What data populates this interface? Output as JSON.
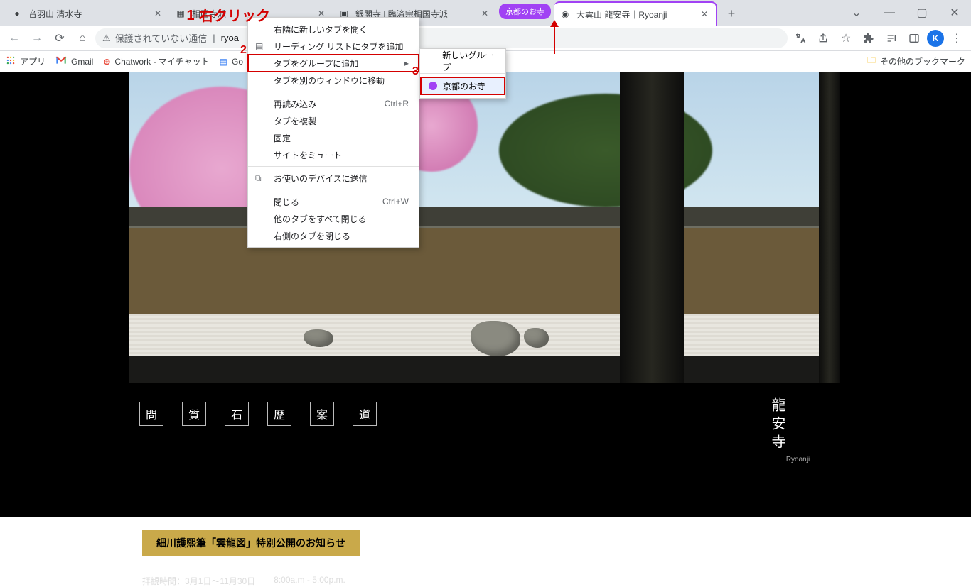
{
  "tabs": [
    {
      "title": "音羽山 清水寺",
      "favicon": "●"
    },
    {
      "title": "相国寺派",
      "favicon": "▦"
    },
    {
      "title": "銀閣寺 | 臨済宗相国寺派",
      "favicon": "▣"
    },
    {
      "title": "大雲山 龍安寺｜Ryoanji",
      "favicon": "◉"
    }
  ],
  "tab_group_chip": "京都のお寺",
  "new_tab_plus": "+",
  "window_controls": {
    "min": "—",
    "max": "▢",
    "close": "✕",
    "chev": "⌄"
  },
  "toolbar": {
    "not_secure": "保護されていない通信",
    "url_fragment": "ryoa",
    "profile_initial": "K"
  },
  "bookmarks": {
    "apps": "アプリ",
    "gmail": "Gmail",
    "chatwork": "Chatwork - マイチャット",
    "google": "Go",
    "other": "その他のブックマーク"
  },
  "context_menu": {
    "open_right": "右隣に新しいタブを開く",
    "reading_list": "リーディング リストにタブを追加",
    "add_to_group": "タブをグループに追加",
    "move_window": "タブを別のウィンドウに移動",
    "reload": "再読み込み",
    "reload_key": "Ctrl+R",
    "duplicate": "タブを複製",
    "pin": "固定",
    "mute": "サイトをミュート",
    "send_device": "お使いのデバイスに送信",
    "close": "閉じる",
    "close_key": "Ctrl+W",
    "close_others": "他のタブをすべて閉じる",
    "close_right": "右側のタブを閉じる"
  },
  "submenu": {
    "new_group": "新しいグループ",
    "existing_group": "京都のお寺"
  },
  "page": {
    "nav": [
      "問",
      "質",
      "石",
      "歴",
      "案",
      "道"
    ],
    "logo_kanji": "龍安寺",
    "logo_roma": "Ryoanji",
    "notice": "細川護煕筆「雲龍図」特別公開のお知らせ",
    "hours_label": "拝観時間：",
    "hours_dates": "3月1日～11月30日",
    "hours_time": "8:00a.m - 5:00p.m."
  },
  "annotations": {
    "one_num": "1",
    "one_text": "右クリック",
    "two": "2",
    "three": "3"
  }
}
